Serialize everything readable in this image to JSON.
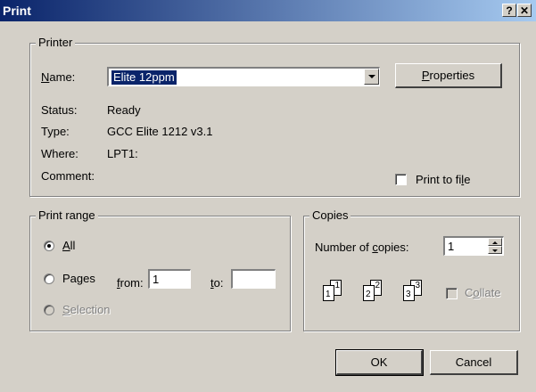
{
  "window": {
    "title": "Print",
    "help_glyph": "?",
    "close_glyph": "✕"
  },
  "printer": {
    "legend": "Printer",
    "name_label_pre": "",
    "name_label_u": "N",
    "name_label_post": "ame:",
    "name_value": "Elite 12ppm",
    "properties_u": "P",
    "properties_post": "roperties",
    "status_label": "Status:",
    "status_value": "Ready",
    "type_label": "Type:",
    "type_value": "GCC Elite 1212 v3.1",
    "where_label": "Where:",
    "where_value": "LPT1:",
    "comment_label": "Comment:",
    "print_to_file_pre": "Print to fi",
    "print_to_file_u": "l",
    "print_to_file_post": "e",
    "print_to_file_checked": false
  },
  "print_range": {
    "legend": "Print range",
    "all_u": "A",
    "all_post": "ll",
    "all_selected": true,
    "pages_pre": "Pa",
    "pages_u": "g",
    "pages_post": "es",
    "from_u": "f",
    "from_post": "rom:",
    "from_value": "1",
    "to_u": "t",
    "to_post": "o:",
    "to_value": "",
    "selection_u": "S",
    "selection_post": "election"
  },
  "copies": {
    "legend": "Copies",
    "number_pre": "Number of ",
    "number_u": "c",
    "number_post": "opies:",
    "value": "1",
    "collate_pre": "C",
    "collate_u": "o",
    "collate_post": "llate",
    "collate_checked": false,
    "pages": [
      "1",
      "1",
      "2",
      "2",
      "3",
      "3"
    ]
  },
  "actions": {
    "ok": "OK",
    "cancel": "Cancel"
  }
}
